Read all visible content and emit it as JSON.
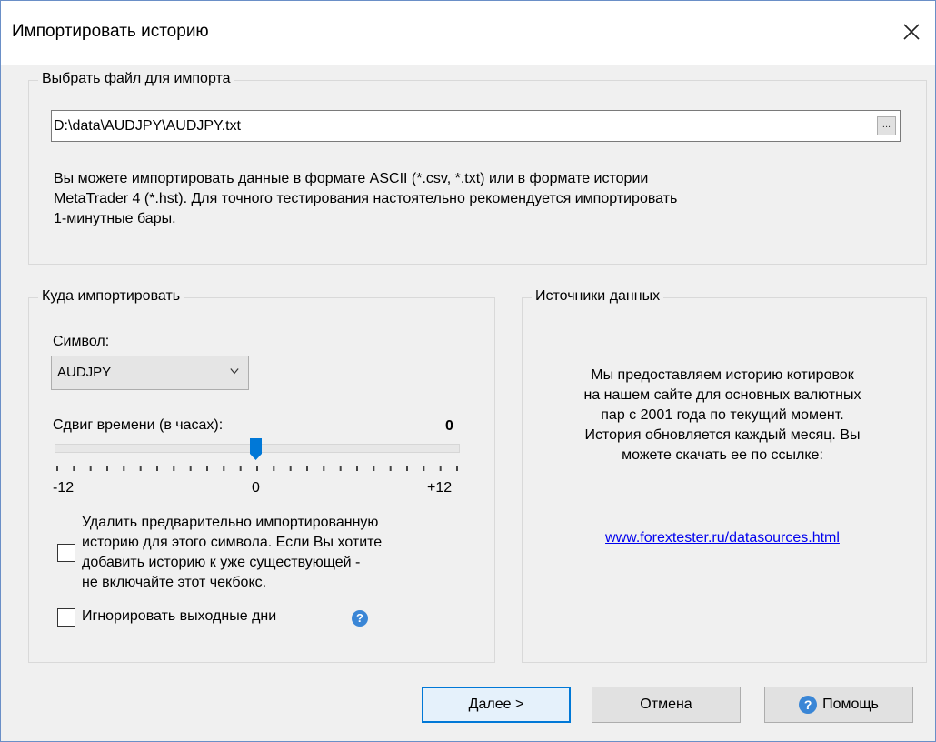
{
  "window": {
    "title": "Импортировать историю"
  },
  "file_section": {
    "legend": "Выбрать файл для импорта",
    "file_path": "D:\\data\\AUDJPY\\AUDJPY.txt",
    "browse_label": "...",
    "info_line1": "Вы можете импортировать данные в формате ASCII (*.csv, *.txt) или в формате истории",
    "info_line2": "MetaTrader 4 (*.hst). Для точного тестирования настоятельно рекомендуется импортировать",
    "info_line3": "1-минутные бары."
  },
  "import_section": {
    "legend": "Куда импортировать",
    "symbol_label": "Символ:",
    "symbol_value": "AUDJPY",
    "time_shift_label": "Сдвиг времени (в часах):",
    "time_shift_value": "0",
    "slider_min": "-12",
    "slider_mid": "0",
    "slider_max": "+12",
    "delete_prev_line1": "Удалить предварительно импортированную",
    "delete_prev_line2": "историю для этого символа. Если Вы хотите",
    "delete_prev_line3": "добавить историю к уже существующей -",
    "delete_prev_line4": "не включайте этот чекбокс.",
    "ignore_weekends_label": "Игнорировать выходные дни",
    "help_glyph": "?"
  },
  "sources_section": {
    "legend": "Источники данных",
    "text_line1": "Мы предоставляем историю котировок",
    "text_line2": "на нашем сайте для основных валютных",
    "text_line3": "пар с 2001 года по текущий момент.",
    "text_line4": "История обновляется каждый месяц. Вы",
    "text_line5": "можете скачать ее по ссылке:",
    "link": "www.forextester.ru/datasources.html"
  },
  "buttons": {
    "next": "Далее >",
    "cancel": "Отмена",
    "help": "Помощь"
  },
  "colors": {
    "window_border": "#6a8fc7",
    "slider_thumb": "#0078d7",
    "link": "#0000ee",
    "help_icon": "#3a86d6"
  }
}
